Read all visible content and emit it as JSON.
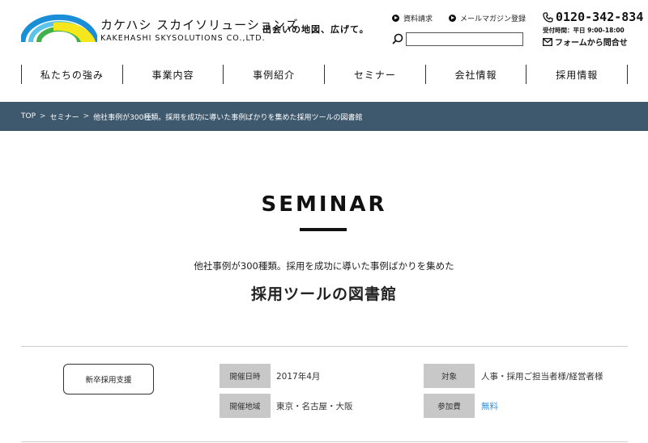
{
  "brand": {
    "name_jp": "カケハシ スカイソリューションズ",
    "name_en": "KAKEHASHI SKYSOLUTIONS CO.,LTD.",
    "tagline": "出会いの地図、広げて。",
    "logo_colors": [
      "#1a8fd8",
      "#5ec3ea",
      "#3fb04a",
      "#f6e61c"
    ]
  },
  "header_links": {
    "request_docs": "資料請求",
    "newsletter": "メールマガジン登録"
  },
  "search": {
    "value": "",
    "placeholder": ""
  },
  "contact": {
    "phone": "0120-342-834",
    "hours": "受付時間：平日 9:00-18:00",
    "form_link": "フォームから問合せ"
  },
  "nav": {
    "items": [
      {
        "label": "私たちの強み"
      },
      {
        "label": "事業内容"
      },
      {
        "label": "事例紹介"
      },
      {
        "label": "セミナー"
      },
      {
        "label": "会社情報"
      },
      {
        "label": "採用情報"
      }
    ]
  },
  "breadcrumb": {
    "items": [
      "TOP",
      "セミナー",
      "他社事例が300種類。採用を成功に導いた事例ばかりを集めた採用ツールの図書館"
    ],
    "separator": ">",
    "bar_color": "#3e586d"
  },
  "page": {
    "section_title": "SEMINAR",
    "subtitle": "他社事例が300種類。採用を成功に導いた事例ばかりを集めた",
    "title": "採用ツールの図書館"
  },
  "seminar_info": {
    "category_tag": "新卒採用支援",
    "date_label": "開催日時",
    "date_value": "2017年4月",
    "area_label": "開催地域",
    "area_value": "東京・名古屋・大阪",
    "target_label": "対象",
    "target_value": "人事・採用ご担当者様/経営者様",
    "fee_label": "参加費",
    "fee_value": "無料",
    "fee_color": "#3b8fd1"
  }
}
